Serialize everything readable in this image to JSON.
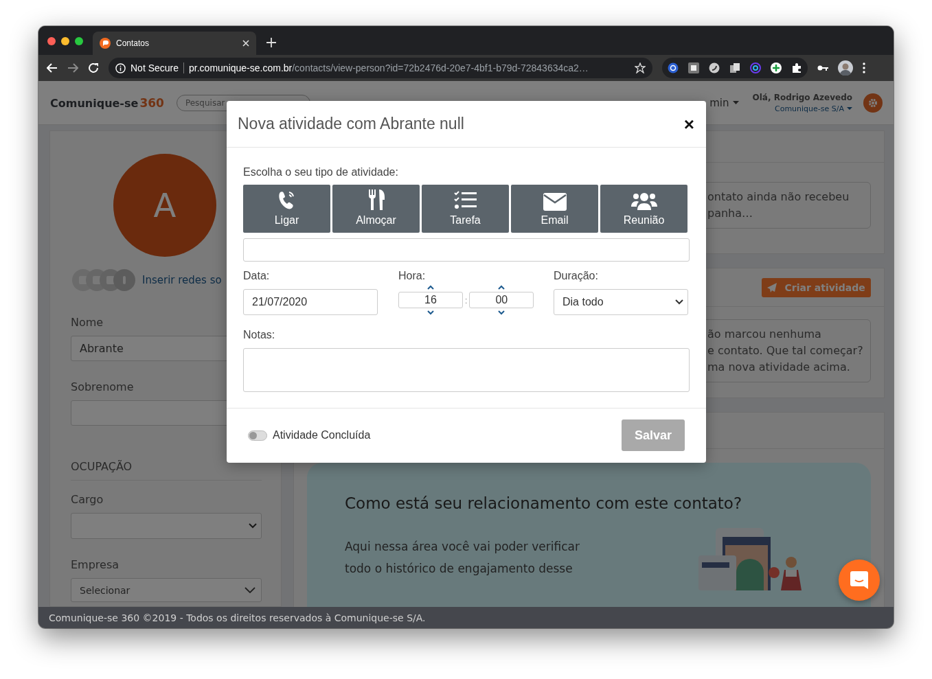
{
  "browser": {
    "tab_title": "Contatos",
    "security": "Not Secure",
    "url_host": "pr.comunique-se.com.br",
    "url_path": "/contacts/view-person?id=72b2476d-20e7-4bf1-b79d-72843634ca2…"
  },
  "header": {
    "logo_text": "Comunique-se",
    "logo_number": "360",
    "search_placeholder": "Pesquisar",
    "nav_item": "min",
    "greeting": "Olá, Rodrigo Azevedo",
    "company": "Comunique-se S/A"
  },
  "profile": {
    "initial": "A",
    "social_link": "Inserir redes so",
    "fields": [
      {
        "kind": "text",
        "label": "Nome",
        "value": "Abrante"
      },
      {
        "kind": "text",
        "label": "Sobrenome"
      },
      {
        "kind": "section",
        "label": "OCUPAÇÃO"
      },
      {
        "kind": "select",
        "label": "Cargo"
      },
      {
        "kind": "select-small",
        "label": "Empresa",
        "value": "Selecionar"
      }
    ]
  },
  "panels": {
    "campaign_lines": [
      "ontato ainda não recebeu",
      "panha…"
    ],
    "create_button": "Criar atividade",
    "activity_lines": [
      "ão marcou nenhuma",
      "e contato. Que tal começar?",
      "ma nova atividade acima."
    ],
    "banner_title": "Como está seu relacionamento com este contato?",
    "banner_lines": [
      "Aqui nessa área você vai poder verificar",
      "todo o histórico de engajamento desse"
    ]
  },
  "footer": "Comunique-se 360 ©2019 - Todos os direitos reservados à Comunique-se S/A.",
  "modal": {
    "title": "Nova atividade com Abrante null",
    "close": "×",
    "type_prompt": "Escolha o seu tipo de atividade:",
    "types": [
      {
        "kind": "call",
        "label": "Ligar",
        "selected": false
      },
      {
        "kind": "lunch",
        "label": "Almoçar",
        "selected": false
      },
      {
        "kind": "task",
        "label": "Tarefa",
        "selected": false
      },
      {
        "kind": "email",
        "label": "Email",
        "selected": false
      },
      {
        "kind": "meeting",
        "label": "Reunião",
        "selected": false
      }
    ],
    "date_label": "Data:",
    "date_value": "21/07/2020",
    "time_label": "Hora:",
    "hour": "16",
    "separator": ":",
    "minute": "00",
    "duration_label": "Duração:",
    "duration_value": "Dia todo",
    "notes_label": "Notas:",
    "done_label": "Atividade Concluída",
    "done_on": false,
    "save_label": "Salvar",
    "save_disabled": true
  }
}
